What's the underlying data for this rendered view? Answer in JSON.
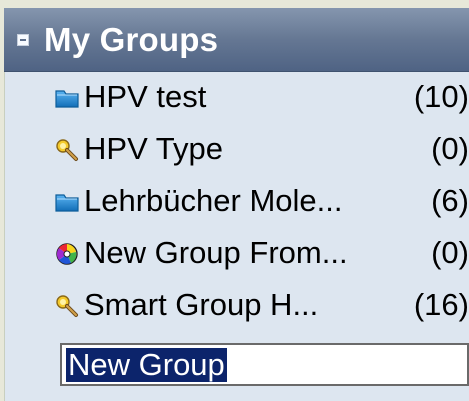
{
  "groups_panel": {
    "title": "My Groups",
    "collapse_icon": "collapse-minus-icon",
    "items": [
      {
        "label": "HPV test",
        "count": "(10)",
        "icon": "folder-icon"
      },
      {
        "label": "HPV Type",
        "count": "(0)",
        "icon": "smart-group-icon"
      },
      {
        "label": "Lehrbücher Mole...",
        "count": "(6)",
        "icon": "folder-icon"
      },
      {
        "label": "New Group From...",
        "count": "(0)",
        "icon": "color-wheel-group-icon"
      },
      {
        "label": "Smart Group H...",
        "count": "(16)",
        "icon": "smart-group-icon"
      }
    ],
    "rename_field": {
      "value": "New Group"
    }
  },
  "colors": {
    "header_top": "#8596ae",
    "header_bottom": "#4f6384",
    "pane_background": "#dde6f0",
    "selection": "#0c246b",
    "folder_blue": "#247fc2"
  }
}
